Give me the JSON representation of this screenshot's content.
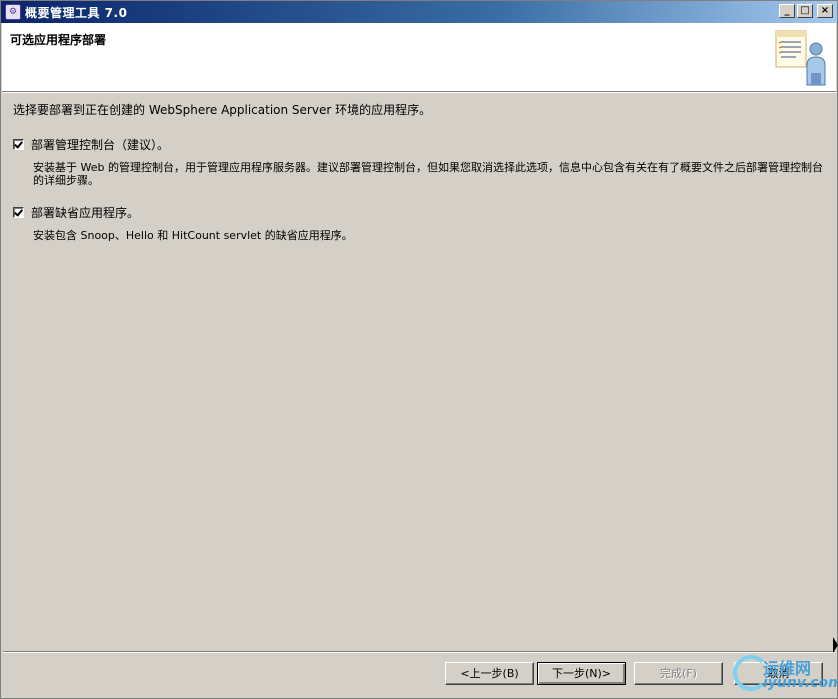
{
  "window": {
    "title": "概要管理工具 7.0",
    "app_icon": "wizard-app-icon",
    "controls": {
      "minimize": "_",
      "maximize": "□",
      "close": "×"
    }
  },
  "header": {
    "title": "可选应用程序部署",
    "graphic": "document-person-icon"
  },
  "main": {
    "intro": "选择要部署到正在创建的 WebSphere Application Server 环境的应用程序。",
    "options": [
      {
        "label": "部署管理控制台（建议）。",
        "checked": true,
        "description": "安装基于 Web 的管理控制台，用于管理应用程序服务器。建议部署管理控制台，但如果您取消选择此选项，信息中心包含有关在有了概要文件之后部署管理控制台的详细步骤。"
      },
      {
        "label": "部署缺省应用程序。",
        "checked": true,
        "description": "安装包含 Snoop、Hello 和 HitCount servlet 的缺省应用程序。"
      }
    ]
  },
  "footer": {
    "back": "<上一步(B)",
    "next": "下一步(N)>",
    "finish": "完成(F)",
    "cancel": "取消"
  },
  "watermark": {
    "cn": "运维网",
    "en": "iyunv.com"
  },
  "colors": {
    "titlebar_start": "#0a246a",
    "window_bg": "#d4d0c8",
    "header_bg": "#ffffff"
  }
}
